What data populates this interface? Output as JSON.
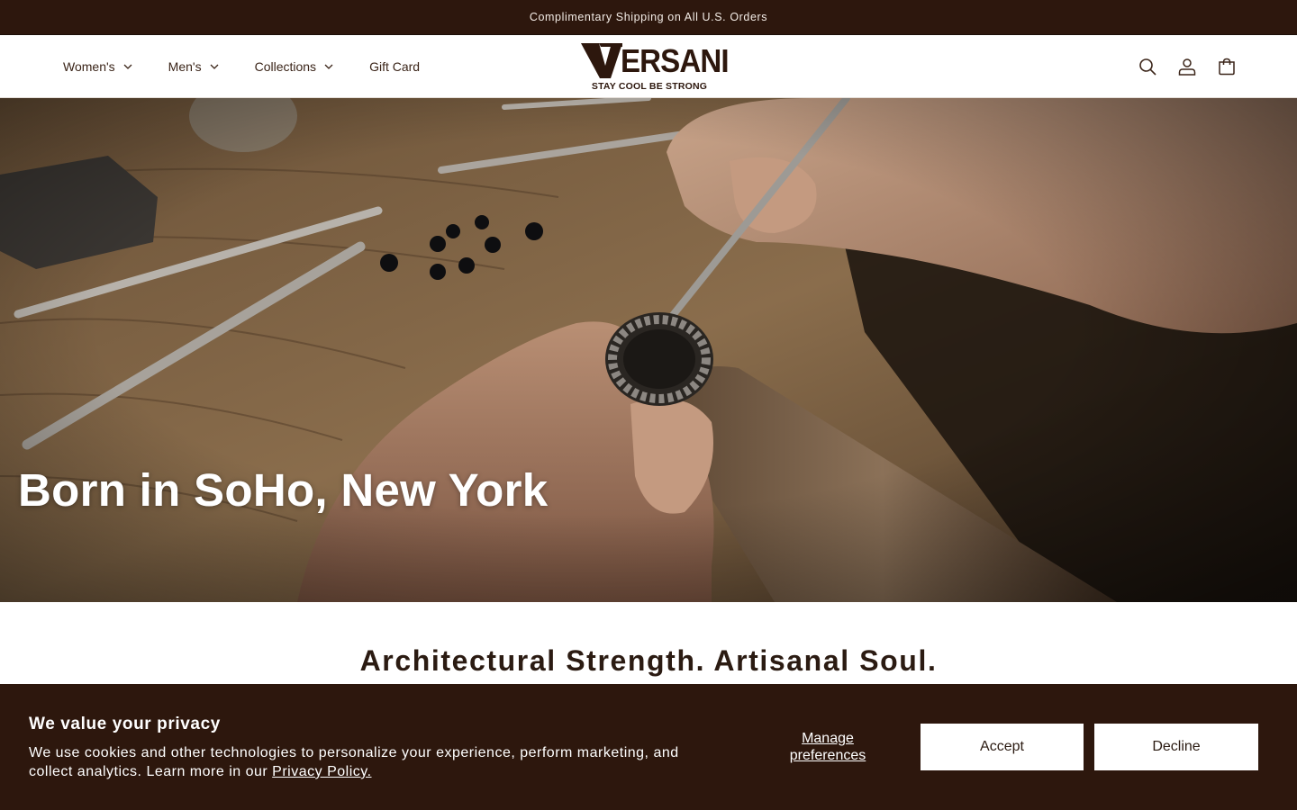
{
  "announcement": {
    "text": "Complimentary Shipping on All U.S. Orders"
  },
  "header": {
    "nav": [
      {
        "label": "Women's",
        "has_dropdown": true
      },
      {
        "label": "Men's",
        "has_dropdown": true
      },
      {
        "label": "Collections",
        "has_dropdown": true
      },
      {
        "label": "Gift Card",
        "has_dropdown": false
      }
    ],
    "logo": {
      "wordmark": "VERSANI",
      "tagline": "STAY COOL BE STRONG"
    },
    "icons": [
      "search-icon",
      "account-icon",
      "cart-icon"
    ]
  },
  "hero": {
    "title": "Born in SoHo, New York",
    "image": "jeweler-hands-setting-black-stones-in-silver-ring-icon"
  },
  "section": {
    "tagline": "Architectural Strength. Artisanal Soul."
  },
  "cookie_banner": {
    "title": "We value your privacy",
    "body": "We use cookies and other technologies to personalize your experience, perform marketing, and collect analytics. Learn more in our",
    "link": "Privacy Policy.",
    "manage_line1": "Manage",
    "manage_line2": "preferences",
    "accept": "Accept",
    "decline": "Decline"
  },
  "colors": {
    "brand_dark": "#2d170d",
    "text": "#2b1b12",
    "white": "#ffffff"
  }
}
